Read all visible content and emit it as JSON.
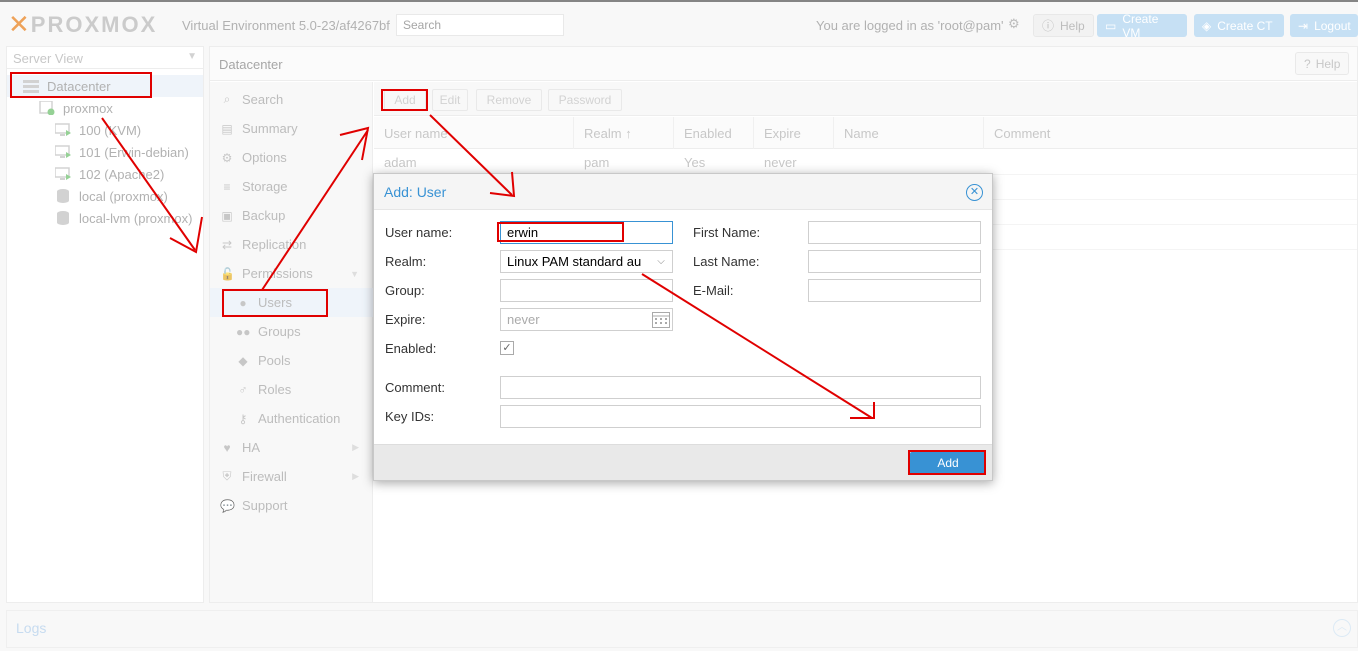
{
  "header": {
    "logo_text": "PROXMOX",
    "version": "Virtual Environment 5.0-23/af4267bf",
    "search_placeholder": "Search",
    "logged_in": "You are logged in as 'root@pam'",
    "help": "Help",
    "create_vm": "Create VM",
    "create_ct": "Create CT",
    "logout": "Logout"
  },
  "tree": {
    "view": "Server View",
    "items": [
      {
        "label": "Datacenter",
        "icon": "server-stack-icon"
      },
      {
        "label": "proxmox",
        "icon": "node-icon"
      },
      {
        "label": "100 (KVM)",
        "icon": "monitor-icon"
      },
      {
        "label": "101 (Erwin-debian)",
        "icon": "monitor-icon"
      },
      {
        "label": "102 (Apache2)",
        "icon": "monitor-icon"
      },
      {
        "label": "local (proxmox)",
        "icon": "database-icon"
      },
      {
        "label": "local-lvm (proxmox)",
        "icon": "database-icon"
      }
    ]
  },
  "content": {
    "title": "Datacenter",
    "help": "Help"
  },
  "menu": {
    "items": [
      {
        "label": "Search",
        "icon": "search-icon"
      },
      {
        "label": "Summary",
        "icon": "book-icon"
      },
      {
        "label": "Options",
        "icon": "gear-icon"
      },
      {
        "label": "Storage",
        "icon": "database-icon"
      },
      {
        "label": "Backup",
        "icon": "floppy-icon"
      },
      {
        "label": "Replication",
        "icon": "retweet-icon"
      },
      {
        "label": "Permissions",
        "icon": "unlock-icon"
      },
      {
        "label": "Users",
        "icon": "user-icon"
      },
      {
        "label": "Groups",
        "icon": "users-icon"
      },
      {
        "label": "Pools",
        "icon": "tags-icon"
      },
      {
        "label": "Roles",
        "icon": "male-icon"
      },
      {
        "label": "Authentication",
        "icon": "key-icon"
      },
      {
        "label": "HA",
        "icon": "heartbeat-icon"
      },
      {
        "label": "Firewall",
        "icon": "shield-icon"
      },
      {
        "label": "Support",
        "icon": "comments-icon"
      }
    ]
  },
  "users_grid": {
    "toolbar": [
      "Add",
      "Edit",
      "Remove",
      "Password"
    ],
    "columns": [
      "User name",
      "Realm",
      "Enabled",
      "Expire",
      "Name",
      "Comment"
    ],
    "rows": [
      {
        "user": "adam",
        "realm": "pam",
        "enabled": "Yes",
        "expire": "never"
      }
    ]
  },
  "dialog": {
    "title": "Add: User",
    "labels": {
      "username": "User name:",
      "realm": "Realm:",
      "group": "Group:",
      "expire": "Expire:",
      "enabled": "Enabled:",
      "firstname": "First Name:",
      "lastname": "Last Name:",
      "email": "E-Mail:",
      "comment": "Comment:",
      "keyids": "Key IDs:"
    },
    "values": {
      "username": "erwin",
      "realm": "Linux PAM standard au",
      "expire_placeholder": "never",
      "enabled": true
    },
    "add_button": "Add"
  },
  "logs": {
    "title": "Logs"
  },
  "colors": {
    "accent": "#3892d4",
    "annotation": "#e00000",
    "logo_x": "#e57000"
  }
}
